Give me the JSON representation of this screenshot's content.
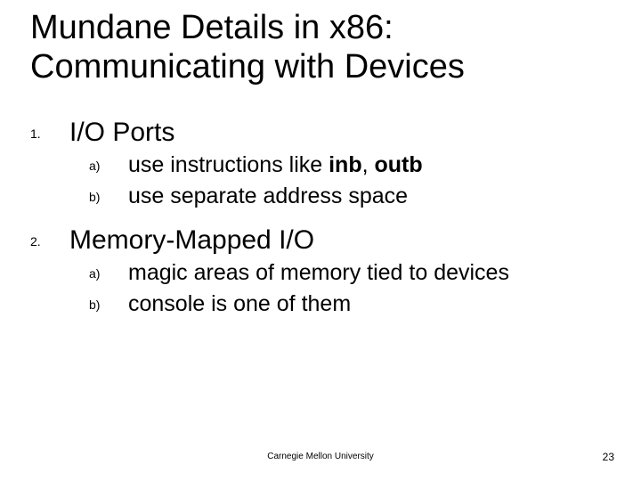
{
  "title": "Mundane Details in x86: Communicating with Devices",
  "items": [
    {
      "num": "1.",
      "text": "I/O Ports",
      "sub": [
        {
          "num": "a)",
          "pre": "use instructions like ",
          "b1": "inb",
          "mid": ", ",
          "b2": "outb"
        },
        {
          "num": "b)",
          "text": "use separate address space"
        }
      ]
    },
    {
      "num": "2.",
      "text": "Memory-Mapped I/O",
      "sub": [
        {
          "num": "a)",
          "text": "magic areas of memory tied to devices"
        },
        {
          "num": "b)",
          "text": "console is one of them"
        }
      ]
    }
  ],
  "footer": {
    "center": "Carnegie Mellon University",
    "page": "23"
  }
}
